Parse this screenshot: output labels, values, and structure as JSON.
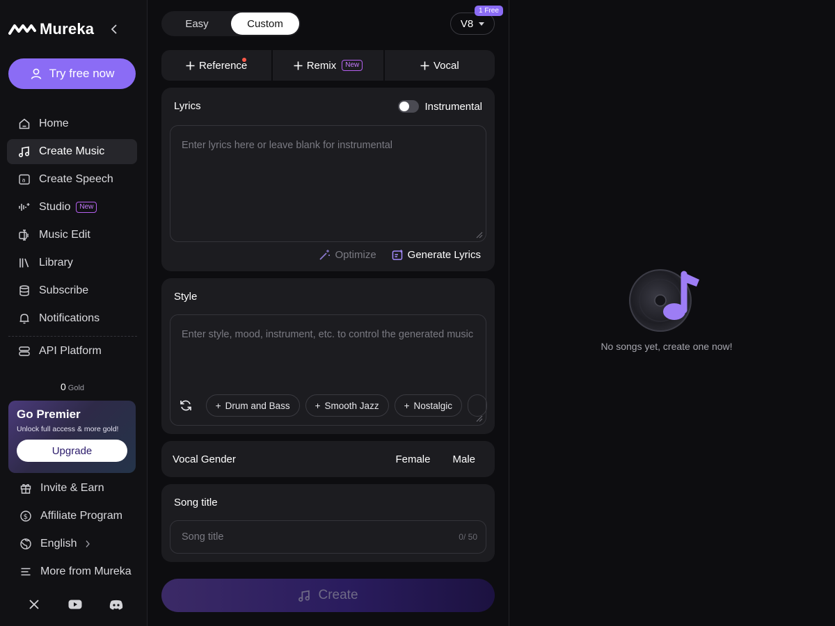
{
  "brand": {
    "name": "Mureka"
  },
  "sidebar": {
    "try_button": "Try free now",
    "nav": [
      {
        "label": "Home",
        "icon": "home-icon"
      },
      {
        "label": "Create Music",
        "icon": "music-note-icon",
        "active": true
      },
      {
        "label": "Create Speech",
        "icon": "speech-icon"
      },
      {
        "label": "Studio",
        "icon": "studio-icon",
        "badge": "New"
      },
      {
        "label": "Music Edit",
        "icon": "music-edit-icon"
      },
      {
        "label": "Library",
        "icon": "library-icon"
      },
      {
        "label": "Subscribe",
        "icon": "database-icon"
      },
      {
        "label": "Notifications",
        "icon": "bell-icon"
      }
    ],
    "api": {
      "label": "API Platform",
      "icon": "api-icon"
    },
    "gold": {
      "amount": "0",
      "label": "Gold"
    },
    "premier": {
      "title": "Go Premier",
      "subtitle": "Unlock full access & more gold!",
      "button": "Upgrade"
    },
    "bottom": [
      {
        "label": "Invite & Earn",
        "icon": "gift-icon"
      },
      {
        "label": "Affiliate Program",
        "icon": "dollar-icon"
      },
      {
        "label": "English",
        "icon": "globe-icon"
      },
      {
        "label": "More from Mureka",
        "icon": "menu-icon"
      }
    ],
    "social": [
      "x-icon",
      "youtube-icon",
      "discord-icon"
    ]
  },
  "form": {
    "mode": {
      "easy": "Easy",
      "custom": "Custom",
      "selected": "Custom"
    },
    "version": {
      "value": "V8",
      "free_badge": "1 Free"
    },
    "tools": {
      "reference": "Reference",
      "remix": "Remix",
      "remix_badge": "New",
      "vocal": "Vocal"
    },
    "lyrics": {
      "title": "Lyrics",
      "instrumental_label": "Instrumental",
      "placeholder": "Enter lyrics here or leave blank for instrumental",
      "optimize": "Optimize",
      "generate": "Generate Lyrics"
    },
    "style": {
      "title": "Style",
      "placeholder": "Enter style, mood, instrument, etc. to control the generated music",
      "chips": [
        "Drum and Bass",
        "Smooth Jazz",
        "Nostalgic"
      ]
    },
    "vocal_gender": {
      "title": "Vocal Gender",
      "female": "Female",
      "male": "Male"
    },
    "song_title": {
      "title": "Song title",
      "placeholder": "Song title",
      "count": "0/ 50"
    },
    "create_button": "Create"
  },
  "results": {
    "empty_text": "No songs yet, create one now!"
  },
  "colors": {
    "accent": "#8b6cf5",
    "background": "#0d0d10",
    "card": "#1c1c20"
  }
}
